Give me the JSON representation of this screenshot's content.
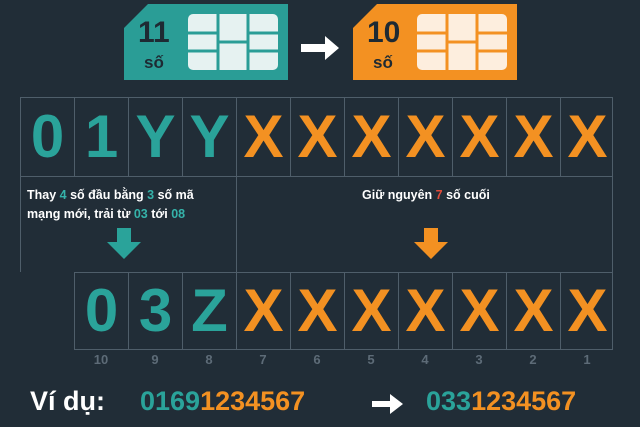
{
  "sim_old": {
    "digits": "11",
    "unit": "số"
  },
  "sim_new": {
    "digits": "10",
    "unit": "số"
  },
  "top_row": [
    "0",
    "1",
    "Y",
    "Y",
    "X",
    "X",
    "X",
    "X",
    "X",
    "X",
    "X"
  ],
  "bottom_row": [
    "0",
    "3",
    "Z",
    "X",
    "X",
    "X",
    "X",
    "X",
    "X",
    "X"
  ],
  "note_left": {
    "line1_a": "Thay ",
    "line1_n1": "4",
    "line1_b": " số đầu bằng ",
    "line1_n2": "3",
    "line1_c": " số mã",
    "line2_a": "mạng mới, trải từ ",
    "line2_n1": "03",
    "line2_b": " tới ",
    "line2_n2": "08"
  },
  "note_right": {
    "a": "Giữ nguyên ",
    "n": "7",
    "b": " số cuối"
  },
  "positions": [
    "10",
    "9",
    "8",
    "7",
    "6",
    "5",
    "4",
    "3",
    "2",
    "1"
  ],
  "example": {
    "label": "Ví dụ:",
    "old_prefix": "0169",
    "old_rest": "1234567",
    "new_prefix": "033",
    "new_rest": "1234567"
  },
  "colors": {
    "teal": "#2aa39a",
    "orange": "#f39122",
    "background": "#212d37"
  }
}
